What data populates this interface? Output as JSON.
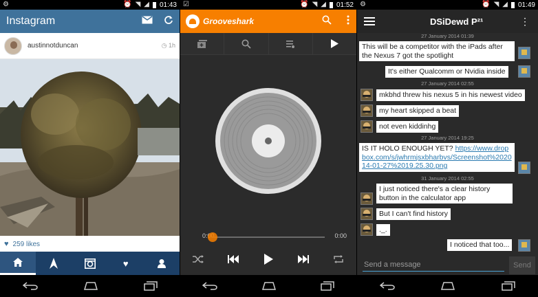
{
  "instagram": {
    "status_time": "01:43",
    "title": "Instagram",
    "username": "austinnotduncan",
    "posted_ago": "1h",
    "likes": "259 likes",
    "icons": {
      "inbox": "inbox-icon",
      "refresh": "refresh-icon",
      "home": "home-icon",
      "explore": "explore-icon",
      "camera": "camera-icon",
      "activity": "heart-icon",
      "profile": "profile-icon"
    }
  },
  "grooveshark": {
    "status_time": "01:52",
    "title": "Grooveshark",
    "current_time": "0:00",
    "duration": "0:00",
    "progress": 0,
    "accent": "#f77f00"
  },
  "hangouts": {
    "status_time": "01:49",
    "title": "DSiDewd P²¹",
    "compose_placeholder": "Send a message",
    "send_label": "Send",
    "messages": [
      {
        "timestamp": "27 January 2014 01:39",
        "text": "This will be a competitor with the iPads after the Nexus 7 got the spotlight"
      },
      {
        "text": "It's either Qualcomm or Nvidia inside"
      },
      {
        "timestamp": "27 January 2014 02:55",
        "text": "mkbhd threw his nexus 5 in his newest video"
      },
      {
        "text": "my heart skipped a beat"
      },
      {
        "text": "not even kiddinhg"
      },
      {
        "timestamp": "27 January 2014 19:25",
        "text": "IS IT HOLO ENOUGH YET?",
        "link": "https://www.dropbox.com/s/jwhrmjsxbharbvs/Screenshot%202014-01-27%2019.25.30.png"
      },
      {
        "timestamp": "31 January 2014 02:55",
        "text": "I just noticed there's a clear history button in the calculator app"
      },
      {
        "text": "But I can't find history"
      },
      {
        "text": "._."
      },
      {
        "text": "I noticed that too..."
      }
    ]
  }
}
